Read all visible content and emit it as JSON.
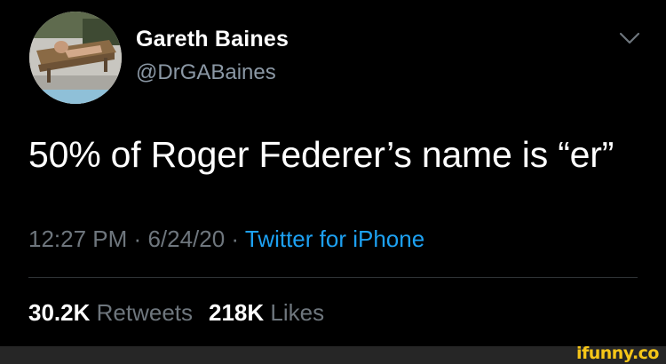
{
  "tweet": {
    "author": {
      "display_name": "Gareth Baines",
      "handle": "@DrGABaines",
      "avatar_icon": "profile-photo"
    },
    "menu_icon": "chevron-down-icon",
    "text": "50% of Roger Federer’s name is “er”",
    "meta": {
      "time": "12:27 PM",
      "separator": "·",
      "date": "6/24/20",
      "source": "Twitter for iPhone"
    },
    "stats": {
      "retweets_count": "30.2K",
      "retweets_label": "Retweets",
      "likes_count": "218K",
      "likes_label": "Likes"
    }
  },
  "watermark": "ifunny.co",
  "colors": {
    "background": "#000000",
    "primary_text": "#ffffff",
    "secondary_text": "#6e767d",
    "link": "#1da1f2",
    "watermark": "#f5c518"
  }
}
